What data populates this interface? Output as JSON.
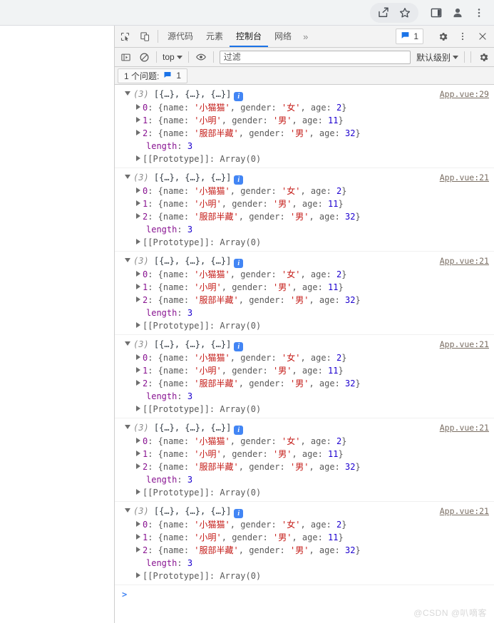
{
  "browser": {
    "actions": [
      {
        "name": "share-icon",
        "label": "分享"
      },
      {
        "name": "bookmark-star-icon",
        "label": "收藏"
      },
      {
        "name": "side-panel-icon",
        "label": "侧边栏"
      },
      {
        "name": "profile-avatar-icon",
        "label": "个人资料"
      },
      {
        "name": "chrome-menu-icon",
        "label": "更多"
      }
    ]
  },
  "devtools": {
    "left_icons": [
      {
        "name": "inspect-element-icon",
        "label": "检查元素"
      },
      {
        "name": "device-toolbar-icon",
        "label": "设备工具栏"
      }
    ],
    "tabs": [
      {
        "label": "源代码",
        "active": false
      },
      {
        "label": "元素",
        "active": false
      },
      {
        "label": "控制台",
        "active": true
      },
      {
        "label": "网络",
        "active": false
      }
    ],
    "more_tabs_label": "»",
    "issues_chip": {
      "icon": "message-icon",
      "count": "1"
    },
    "settings_label": "设置",
    "menu_label": "更多选项",
    "close_label": "关闭",
    "toolbar": {
      "sidebar_toggle": "console-sidebar-icon",
      "clear_console": "clear-console-icon",
      "context_value": "top",
      "eye_label": "实时表达式",
      "filter_placeholder": "过滤",
      "filter_value": "",
      "levels_value": "默认级别",
      "settings_label": "控制台设置"
    },
    "issues_bar": {
      "text": "1 个问题:",
      "icon": "message-icon",
      "count": "1"
    },
    "prompt": ">",
    "watermark": "@CSDN @叭嘀客"
  },
  "console_logs": [
    {
      "source": "App.vue:29",
      "count": "(3)",
      "preview": "[{…}, {…}, {…}]",
      "badge": "i",
      "items": [
        {
          "index": "0",
          "name": "'小猫猫'",
          "gender": "'女'",
          "age": "2"
        },
        {
          "index": "1",
          "name": "'小明'",
          "gender": "'男'",
          "age": "11"
        },
        {
          "index": "2",
          "name": "'服部半藏'",
          "gender": "'男'",
          "age": "32"
        }
      ],
      "length_key": "length",
      "length_value": "3",
      "proto_key": "[[Prototype]]",
      "proto_value": "Array(0)"
    },
    {
      "source": "App.vue:21",
      "count": "(3)",
      "preview": "[{…}, {…}, {…}]",
      "badge": "i",
      "items": [
        {
          "index": "0",
          "name": "'小猫猫'",
          "gender": "'女'",
          "age": "2"
        },
        {
          "index": "1",
          "name": "'小明'",
          "gender": "'男'",
          "age": "11"
        },
        {
          "index": "2",
          "name": "'服部半藏'",
          "gender": "'男'",
          "age": "32"
        }
      ],
      "length_key": "length",
      "length_value": "3",
      "proto_key": "[[Prototype]]",
      "proto_value": "Array(0)"
    },
    {
      "source": "App.vue:21",
      "count": "(3)",
      "preview": "[{…}, {…}, {…}]",
      "badge": "i",
      "items": [
        {
          "index": "0",
          "name": "'小猫猫'",
          "gender": "'女'",
          "age": "2"
        },
        {
          "index": "1",
          "name": "'小明'",
          "gender": "'男'",
          "age": "11"
        },
        {
          "index": "2",
          "name": "'服部半藏'",
          "gender": "'男'",
          "age": "32"
        }
      ],
      "length_key": "length",
      "length_value": "3",
      "proto_key": "[[Prototype]]",
      "proto_value": "Array(0)"
    },
    {
      "source": "App.vue:21",
      "count": "(3)",
      "preview": "[{…}, {…}, {…}]",
      "badge": "i",
      "items": [
        {
          "index": "0",
          "name": "'小猫猫'",
          "gender": "'女'",
          "age": "2"
        },
        {
          "index": "1",
          "name": "'小明'",
          "gender": "'男'",
          "age": "11"
        },
        {
          "index": "2",
          "name": "'服部半藏'",
          "gender": "'男'",
          "age": "32"
        }
      ],
      "length_key": "length",
      "length_value": "3",
      "proto_key": "[[Prototype]]",
      "proto_value": "Array(0)"
    },
    {
      "source": "App.vue:21",
      "count": "(3)",
      "preview": "[{…}, {…}, {…}]",
      "badge": "i",
      "items": [
        {
          "index": "0",
          "name": "'小猫猫'",
          "gender": "'女'",
          "age": "2"
        },
        {
          "index": "1",
          "name": "'小明'",
          "gender": "'男'",
          "age": "11"
        },
        {
          "index": "2",
          "name": "'服部半藏'",
          "gender": "'男'",
          "age": "32"
        }
      ],
      "length_key": "length",
      "length_value": "3",
      "proto_key": "[[Prototype]]",
      "proto_value": "Array(0)"
    },
    {
      "source": "App.vue:21",
      "count": "(3)",
      "preview": "[{…}, {…}, {…}]",
      "badge": "i",
      "items": [
        {
          "index": "0",
          "name": "'小猫猫'",
          "gender": "'女'",
          "age": "2"
        },
        {
          "index": "1",
          "name": "'小明'",
          "gender": "'男'",
          "age": "11"
        },
        {
          "index": "2",
          "name": "'服部半藏'",
          "gender": "'男'",
          "age": "32"
        }
      ],
      "length_key": "length",
      "length_value": "3",
      "proto_key": "[[Prototype]]",
      "proto_value": "Array(0)"
    }
  ],
  "colors": {
    "accent": "#1a73e8",
    "info_badge": "#4285f4",
    "string": "#c41a16",
    "number": "#1c00cf",
    "key": "#881391",
    "link": "#7a6e63"
  }
}
